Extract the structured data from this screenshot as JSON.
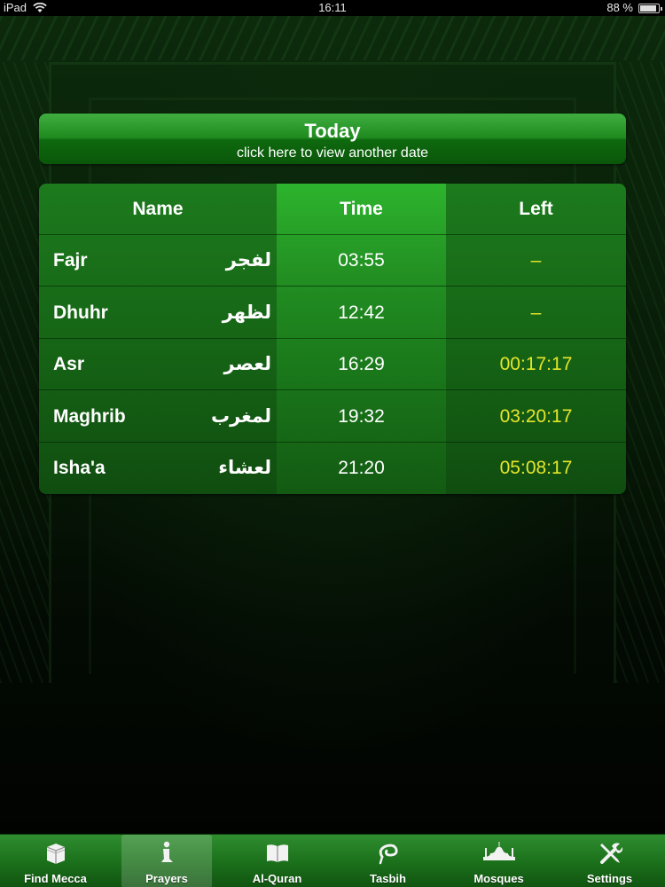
{
  "status_bar": {
    "device": "iPad",
    "time": "16:11",
    "battery": "88 %"
  },
  "date_header": {
    "title": "Today",
    "subtitle": "click here to view another date"
  },
  "table": {
    "headers": {
      "name": "Name",
      "time": "Time",
      "left": "Left"
    },
    "rows": [
      {
        "name": "Fajr",
        "arabic": "لفجر",
        "time": "03:55",
        "left": "–"
      },
      {
        "name": "Dhuhr",
        "arabic": "لظهر",
        "time": "12:42",
        "left": "–"
      },
      {
        "name": "Asr",
        "arabic": "لعصر",
        "time": "16:29",
        "left": "00:17:17"
      },
      {
        "name": "Maghrib",
        "arabic": "لمغرب",
        "time": "19:32",
        "left": "03:20:17"
      },
      {
        "name": "Isha'a",
        "arabic": "لعشاء",
        "time": "21:20",
        "left": "05:08:17"
      }
    ]
  },
  "tab_bar": {
    "selected": "Prayers",
    "tabs": [
      {
        "label": "Find Mecca",
        "icon": "kaaba-icon"
      },
      {
        "label": "Prayers",
        "icon": "prayer-icon"
      },
      {
        "label": "Al-Quran",
        "icon": "book-icon"
      },
      {
        "label": "Tasbih",
        "icon": "prayer-beads-icon"
      },
      {
        "label": "Mosques",
        "icon": "mosque-icon"
      },
      {
        "label": "Settings",
        "icon": "tools-icon"
      }
    ]
  },
  "colors": {
    "accent_green": "#1f8a1f",
    "left_time_yellow": "#e6e62a"
  }
}
